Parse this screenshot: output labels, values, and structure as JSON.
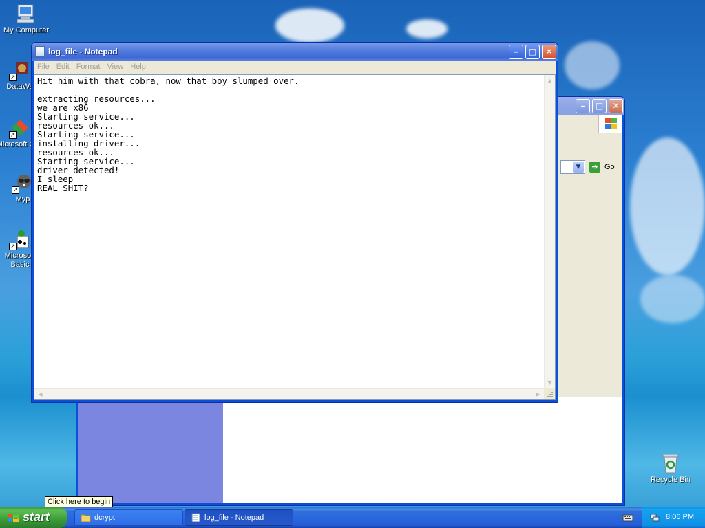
{
  "desktop": {
    "icons": [
      {
        "label": "My Computer"
      },
      {
        "label": "DataWa"
      },
      {
        "label": "Microsoft C++"
      },
      {
        "label": "Myp"
      },
      {
        "label": "Microsoft Basic"
      },
      {
        "label": "Recycle Bin"
      }
    ]
  },
  "bg_window": {
    "go_label": "Go"
  },
  "notepad": {
    "title": "log_file - Notepad",
    "menu": [
      "File",
      "Edit",
      "Format",
      "View",
      "Help"
    ],
    "content": "Hit him with that cobra, now that boy slumped over.\n\nextracting resources...\nwe are x86\nStarting service...\nresources ok...\nStarting service...\ninstalling driver...\nresources ok...\nStarting service...\ndriver detected!\nI sleep\nREAL SHIT?"
  },
  "tooltip": "Click here to begin",
  "taskbar": {
    "start_label": "start",
    "tasks": [
      {
        "label": "dcrypt"
      },
      {
        "label": "log_file - Notepad"
      }
    ],
    "clock": "8:06 PM"
  },
  "colors": {
    "xp_blue": "#0a50d8",
    "start_green": "#3a9b3a",
    "tray_blue": "#1290e6"
  }
}
